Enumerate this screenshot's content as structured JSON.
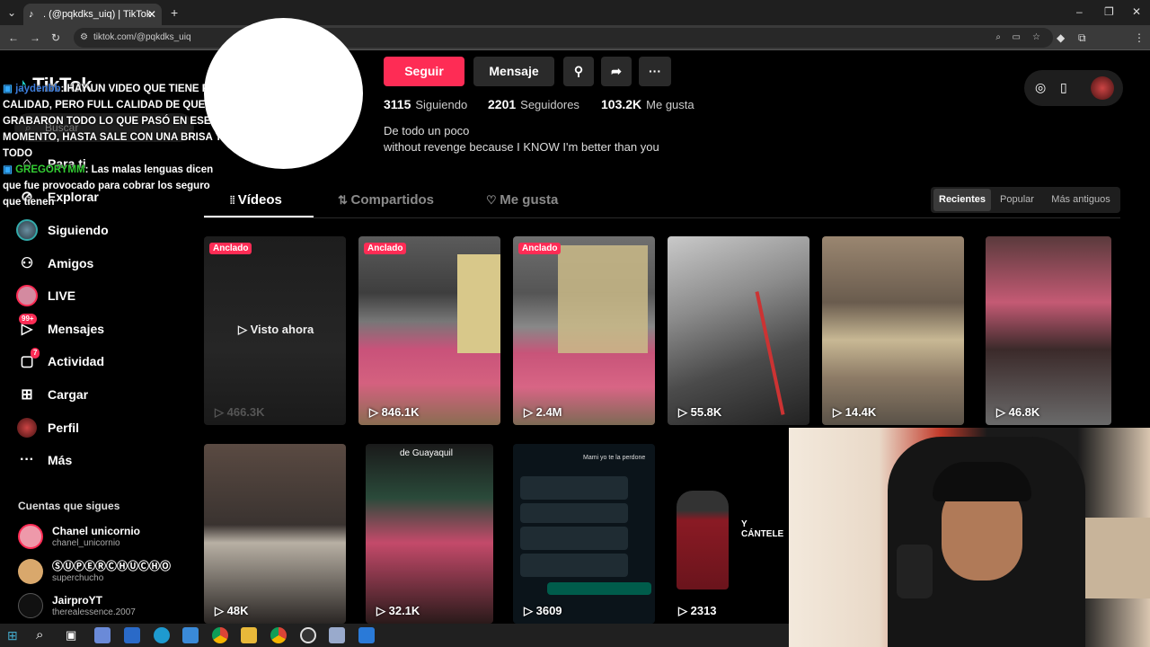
{
  "browser": {
    "tab_title": ". (@pqkdks_uiq) | TikTok",
    "url": "tiktok.com/@pqkdks_uiq"
  },
  "sidebar": {
    "logo": "TikTok",
    "search_placeholder": "Buscar",
    "items": [
      {
        "label": "Para ti",
        "icon": "home-icon"
      },
      {
        "label": "Explorar",
        "icon": "compass-icon"
      },
      {
        "label": "Siguiendo",
        "icon": "following-avatar-icon"
      },
      {
        "label": "Amigos",
        "icon": "friends-icon"
      },
      {
        "label": "LIVE",
        "icon": "live-icon"
      },
      {
        "label": "Mensajes",
        "icon": "message-icon",
        "badge": "99+"
      },
      {
        "label": "Actividad",
        "icon": "activity-icon",
        "badge": "7"
      },
      {
        "label": "Cargar",
        "icon": "upload-icon"
      },
      {
        "label": "Perfil",
        "icon": "profile-avatar-icon"
      },
      {
        "label": "Más",
        "icon": "more-icon"
      }
    ],
    "following_title": "Cuentas que sigues",
    "following": [
      {
        "name": "Chanel unicornio",
        "handle": "chanel_unicornio"
      },
      {
        "name": "ⓈⓊⓅⒺⓇⒸⒽⓊⒸⒽⓄ",
        "handle": "superchucho"
      },
      {
        "name": "JairproYT",
        "handle": "therealessence.2007"
      }
    ]
  },
  "chat": [
    {
      "user": "jaydenbb",
      "msg": ": HAY UN VIDEO QUE TIENE FULL CALIDAD, PERO FULL CALIDAD DE QUE GRABARON TODO LO QUE PASÓ EN ESE MOMENTO, HASTA SALE CON UNA BRISA Y TODO"
    },
    {
      "user": "GREGORYMM",
      "msg": ": Las malas lenguas dicen que fue provocado para cobrar los seguro que tienen"
    }
  ],
  "profile": {
    "follow_label": "Seguir",
    "message_label": "Mensaje",
    "following_count": "3115",
    "following_label": "Siguiendo",
    "followers_count": "2201",
    "followers_label": "Seguidores",
    "likes_count": "103.2K",
    "likes_label": "Me gusta",
    "bio_line1": "De todo un poco",
    "bio_line2": "without revenge because I KNOW I'm better than you"
  },
  "tabs": [
    {
      "label": "Vídeos",
      "active": true
    },
    {
      "label": "Compartidos"
    },
    {
      "label": "Me gusta"
    }
  ],
  "sort": [
    "Recientes",
    "Popular",
    "Más antiguos"
  ],
  "videos_row1": [
    {
      "pinned": "Anclado",
      "views": "466.3K",
      "overlay": "Visto ahora"
    },
    {
      "pinned": "Anclado",
      "views": "846.1K"
    },
    {
      "pinned": "Anclado",
      "views": "2.4M"
    },
    {
      "views": "55.8K"
    },
    {
      "views": "14.4K"
    },
    {
      "views": "46.8K"
    }
  ],
  "videos_row2": [
    {
      "views": "48K"
    },
    {
      "views": "32.1K",
      "caption": "de Guayaquil"
    },
    {
      "views": "3609",
      "caption": "Mami yo te la perdone"
    },
    {
      "views": "2313",
      "caption": "Y CÁNTELE"
    }
  ],
  "colors": {
    "accent": "#fe2c55",
    "bg": "#000000"
  }
}
